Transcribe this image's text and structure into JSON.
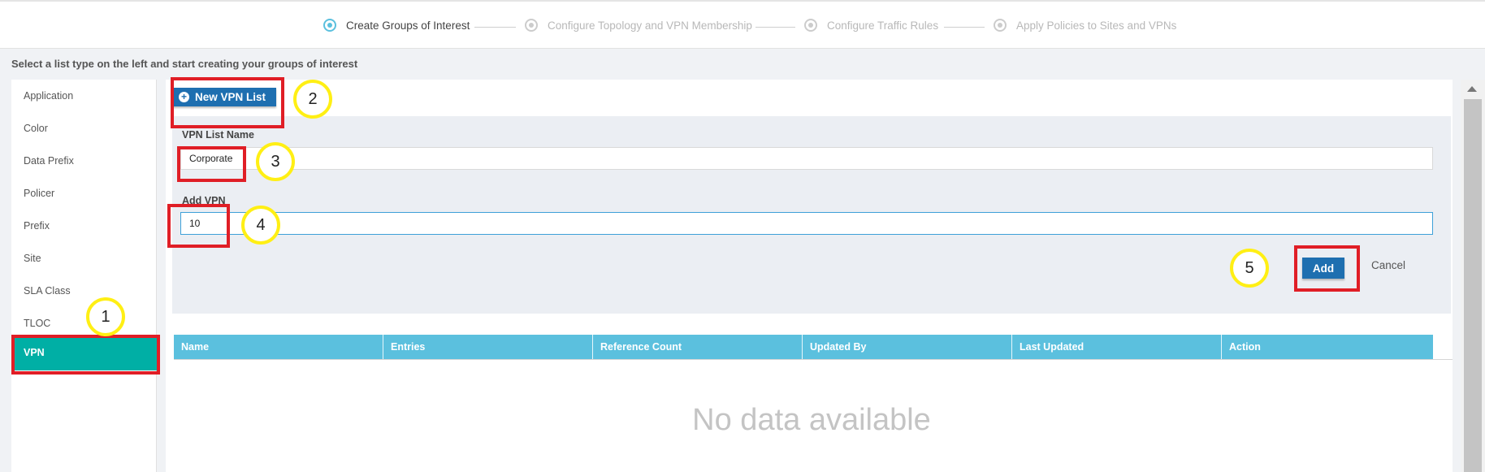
{
  "wizard": {
    "steps": [
      {
        "label": "Create Groups of Interest",
        "active": true
      },
      {
        "label": "Configure Topology and VPN Membership",
        "active": false
      },
      {
        "label": "Configure Traffic Rules",
        "active": false
      },
      {
        "label": "Apply Policies to Sites and VPNs",
        "active": false
      }
    ]
  },
  "instruction": "Select a list type on the left and start creating your groups of interest",
  "sidebar": {
    "items": [
      {
        "label": "Application"
      },
      {
        "label": "Color"
      },
      {
        "label": "Data Prefix"
      },
      {
        "label": "Policer"
      },
      {
        "label": "Prefix"
      },
      {
        "label": "Site"
      },
      {
        "label": "SLA Class"
      },
      {
        "label": "TLOC"
      },
      {
        "label": "VPN",
        "selected": true
      }
    ]
  },
  "toolbar": {
    "new_button_label": "New VPN List"
  },
  "form": {
    "name_label": "VPN List Name",
    "name_value": "Corporate",
    "vpn_label": "Add VPN",
    "vpn_value": "10",
    "add_label": "Add",
    "cancel_label": "Cancel"
  },
  "table": {
    "columns": [
      "Name",
      "Entries",
      "Reference Count",
      "Updated By",
      "Last Updated",
      "Action"
    ],
    "empty_text": "No data available"
  },
  "annotations": {
    "markers": [
      "1",
      "2",
      "3",
      "4",
      "5"
    ],
    "circle_color": "#ffef14",
    "box_color": "#e01e26"
  },
  "colors": {
    "accent": "#1e6fb0",
    "selected": "#00afa5",
    "table_header": "#5bc0de"
  }
}
